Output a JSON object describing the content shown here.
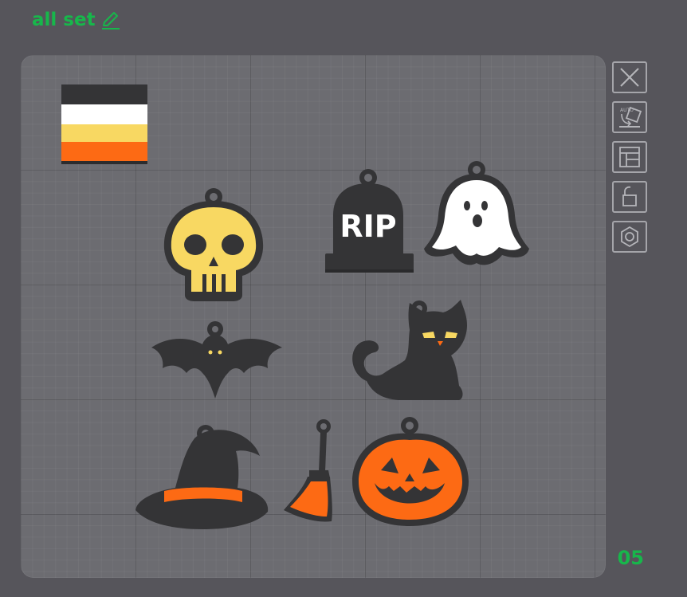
{
  "header": {
    "title": "all set",
    "edit_icon": "pencil-icon"
  },
  "plate": {
    "number": "05"
  },
  "toolbar": {
    "tools": [
      {
        "name": "close",
        "icon": "close-icon"
      },
      {
        "name": "auto-orient",
        "icon": "auto-orient-icon"
      },
      {
        "name": "arrange",
        "icon": "arrange-layout-icon"
      },
      {
        "name": "lock",
        "icon": "lock-icon"
      },
      {
        "name": "settings",
        "icon": "gear-icon"
      }
    ]
  },
  "objects": {
    "rip_text": "RIP"
  },
  "colors": {
    "accent": "#17b74b",
    "background": "#56555b",
    "plate": "#6c6c71",
    "black": "#3a3a3c",
    "yellow": "#f8d862",
    "orange": "#fd6a14",
    "white": "#ffffff"
  }
}
